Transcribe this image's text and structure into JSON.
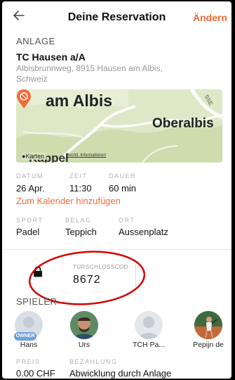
{
  "header": {
    "title": "Deine Reservation",
    "edit_label": "Ändern"
  },
  "facility": {
    "section_label": "ANLAGE",
    "name": "TC Hausen a/A",
    "address": "Albisbrunnweg, 8915 Hausen am Albis, Schweiz"
  },
  "map": {
    "label_city": "am Albis",
    "label_place": "Oberalbis",
    "label_kappel": "Kappel",
    "label_road": "SSE",
    "provider": "Karten",
    "legal": "Rechtl. Informationen"
  },
  "booking": {
    "date_label": "DATUM",
    "date": "26 Apr.",
    "time_label": "ZEIT",
    "time": "11:30",
    "duration_label": "DAUER",
    "duration": "60 min",
    "calendar_link": "Zum Kalender hinzufügen"
  },
  "court": {
    "sport_label": "SPORT",
    "sport": "Padel",
    "surface_label": "BELAG",
    "surface": "Teppich",
    "location_label": "ORT",
    "location": "Aussenplatz"
  },
  "lock": {
    "label": "TÜRSCHLOSSCOD",
    "code": "8672"
  },
  "players": {
    "section_label": "SPIELER",
    "items": [
      {
        "name": "Hans",
        "badge": "OWNER"
      },
      {
        "name": "Urs"
      },
      {
        "name": "TCH Pa..."
      },
      {
        "name": "Pepijn de"
      }
    ]
  },
  "payment": {
    "price_label": "PREIS",
    "price": "0.00 CHF",
    "method_label": "BEZAHLUNG",
    "method": "Abwicklung durch Anlage"
  },
  "colors": {
    "accent": "#f26b3a",
    "annotation": "#d40000",
    "owner_badge": "#6fa3d9"
  }
}
